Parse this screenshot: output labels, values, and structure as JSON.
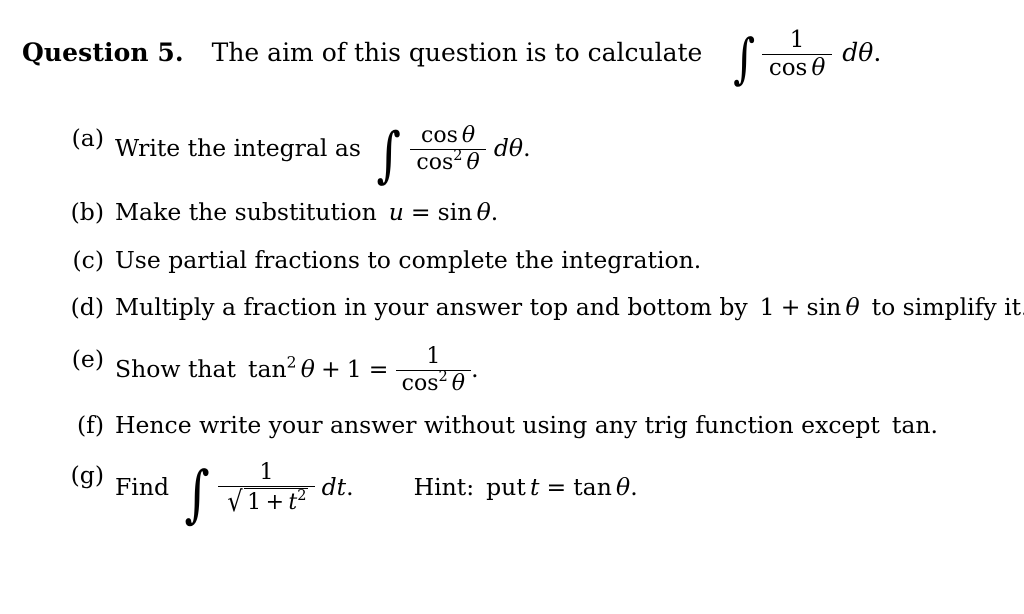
{
  "document": {
    "background_color": "#ffffff",
    "text_color": "#000000"
  },
  "question": {
    "label": "Question 5.",
    "lead_text": "The aim of this question is to calculate",
    "integral": {
      "integral_symbol": "∫",
      "numerator": "1",
      "denominator_function": "cos",
      "denominator_variable": "θ",
      "differential": "dθ",
      "trailing_punctuation": "."
    }
  },
  "parts": [
    {
      "tag": "(a)",
      "text_before": "Write the integral as",
      "math": {
        "integral_symbol": "∫",
        "numerator_function": "cos",
        "numerator_variable": "θ",
        "denominator_function": "cos",
        "denominator_exponent": "2",
        "denominator_variable": "θ",
        "differential": "dθ",
        "trailing_punctuation": "."
      }
    },
    {
      "tag": "(b)",
      "text_before": "Make the substitution",
      "math": {
        "variable": "u",
        "relation": "=",
        "function": "sin",
        "argument": "θ",
        "trailing_punctuation": "."
      }
    },
    {
      "tag": "(c)",
      "text_before": "Use partial fractions to complete the integration.",
      "math": null
    },
    {
      "tag": "(d)",
      "text_before": "Multiply a fraction in your answer top and bottom by",
      "math": {
        "number": "1",
        "operator": "+",
        "function": "sin",
        "argument": "θ"
      },
      "text_after": "to simplify it."
    },
    {
      "tag": "(e)",
      "text_before": "Show that",
      "math": {
        "lhs_function": "tan",
        "lhs_exponent": "2",
        "lhs_variable": "θ",
        "lhs_operator": "+",
        "lhs_number": "1",
        "relation": "=",
        "rhs_numerator": "1",
        "rhs_denominator_function": "cos",
        "rhs_denominator_exponent": "2",
        "rhs_denominator_variable": "θ",
        "trailing_punctuation": "."
      }
    },
    {
      "tag": "(f)",
      "text_before": "Hence write your answer without using any trig function except",
      "math": {
        "function": "tan",
        "trailing_punctuation": "."
      }
    },
    {
      "tag": "(g)",
      "text_before": "Find",
      "math": {
        "integral_symbol": "∫",
        "numerator": "1",
        "denominator_radical": "√",
        "denominator_number": "1",
        "denominator_operator": "+",
        "denominator_variable": "t",
        "denominator_exponent": "2",
        "differential": "dt",
        "trailing_punctuation": "."
      },
      "hint": {
        "label": "Hint:",
        "instruction": "put",
        "variable": "t",
        "relation": "=",
        "function": "tan",
        "argument": "θ",
        "trailing_punctuation": "."
      }
    }
  ]
}
